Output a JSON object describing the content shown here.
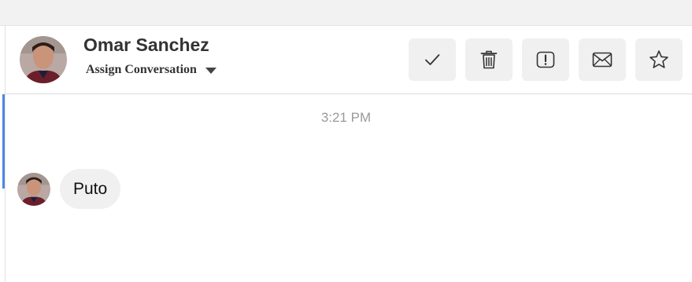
{
  "contact": {
    "name": "Omar Sanchez",
    "assign_label": "Assign Conversation"
  },
  "actions": [
    {
      "icon": "checkmark-icon",
      "name": "mark-done-button"
    },
    {
      "icon": "trash-icon",
      "name": "delete-button"
    },
    {
      "icon": "spam-icon",
      "name": "mark-spam-button"
    },
    {
      "icon": "mail-icon",
      "name": "mark-unread-button"
    },
    {
      "icon": "star-icon",
      "name": "star-button"
    }
  ],
  "conversation": {
    "timestamp": "3:21 PM",
    "messages": [
      {
        "text": "Puto",
        "direction": "incoming"
      }
    ]
  },
  "colors": {
    "accent": "#4a86e8",
    "button_bg": "#f0f0f0",
    "bubble_bg": "#f0f0f0"
  }
}
